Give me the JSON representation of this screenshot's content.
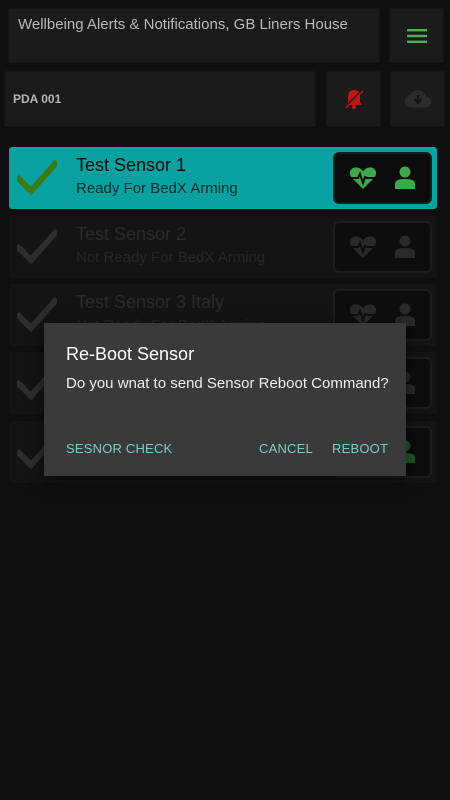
{
  "header": {
    "title": "Wellbeing Alerts & Notifications, GB Liners House",
    "menu_icon": "hamburger-menu-icon"
  },
  "toolbar": {
    "pda_label": "PDA 001",
    "mute_icon": "notification-muted-icon",
    "cloud_icon": "cloud-download-icon"
  },
  "sensors": [
    {
      "name": "Test Sensor 1",
      "status": "Ready For BedX Arming",
      "state": "active"
    },
    {
      "name": "Test Sensor 2",
      "status": "Not Ready For BedX Arming",
      "state": "dim"
    },
    {
      "name": "Test Sensor 3 Italy",
      "status": "Not Ready For BedX Arming",
      "state": "dim"
    },
    {
      "name": "",
      "status": "",
      "state": "dim"
    },
    {
      "name": "",
      "status": "",
      "state": "dim"
    }
  ],
  "dialog": {
    "title": "Re-Boot Sensor",
    "message": "Do you wnat to send Sensor Reboot Command?",
    "check_label": "SESNOR CHECK",
    "cancel_label": "CANCEL",
    "reboot_label": "REBOOT"
  },
  "colors": {
    "accent_teal": "#0aa1a1",
    "accent_green": "#4caf50",
    "mute_red": "#d01818",
    "dialog_button": "#7fcbc9"
  }
}
